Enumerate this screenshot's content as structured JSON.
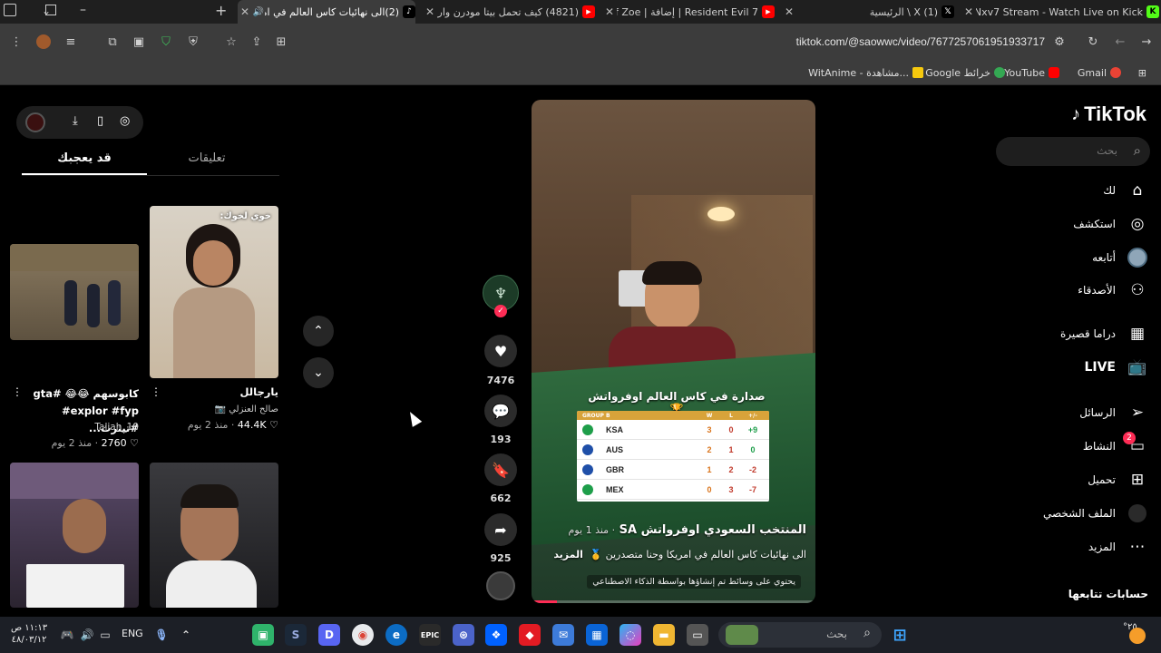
{
  "tabs": [
    {
      "title": "Nxv7 Stream - Watch Live on Kick",
      "favicon": "kick-icon",
      "color": "#53fc18"
    },
    {
      "title": "(1) X \\ الرئيسية",
      "favicon": "x-icon",
      "color": "#000000"
    },
    {
      "title": "Resident Evil 7 | إضافة | End of Zoe",
      "favicon": "youtube-icon",
      "color": "#ff0000"
    },
    {
      "title": "(4821) كيف تحمل بيتا مودرن وارفير",
      "favicon": "youtube-icon",
      "color": "#ff0000"
    },
    {
      "title": "(2)الى نهائيات كاس العالم في امريكا",
      "favicon": "tiktok-icon",
      "color": "#000000"
    }
  ],
  "address": {
    "url": "tiktok.com/@saowwc/video/7677257061951933717"
  },
  "bookmarks": [
    {
      "label": "Gmail",
      "icon": "gmail-icon",
      "color": "#ea4335"
    },
    {
      "label": "YouTube",
      "icon": "youtube-icon",
      "color": "#ff0000"
    },
    {
      "label": "Google خرائط",
      "icon": "maps-icon",
      "color": "#34a853"
    },
    {
      "label": "WitAnime - مشاهدة...",
      "icon": "witanime-icon",
      "color": "#f6c90e"
    }
  ],
  "sidebar": {
    "brand": "TikTok",
    "search_placeholder": "بحث",
    "items": [
      {
        "label": "لك",
        "icon": "home-icon"
      },
      {
        "label": "استكشف",
        "icon": "compass-icon"
      },
      {
        "label": "أتابعه",
        "icon": "following-avatar-icon"
      },
      {
        "label": "الأصدقاء",
        "icon": "friends-icon"
      },
      {
        "label": "دراما قصيرة",
        "icon": "film-icon"
      },
      {
        "label": "LIVE",
        "icon": "live-tv-icon"
      },
      {
        "label": "الرسائل",
        "icon": "send-icon"
      },
      {
        "label": "النشاط",
        "icon": "inbox-icon",
        "badge": "2"
      },
      {
        "label": "تحميل",
        "icon": "upload-icon"
      },
      {
        "label": "الملف الشخصي",
        "icon": "profile-avatar-icon"
      },
      {
        "label": "المزيد",
        "icon": "more-dots-icon"
      }
    ],
    "following_header": "حسابات تتابعها"
  },
  "video": {
    "author": "المنتخب السعودي اوفرواتش SA",
    "time": "منذ 1 يوم",
    "caption": "الى نهائيات كاس العالم في امريكا وحنا متصدرين",
    "more": "المزيد",
    "ai_notice": "يحتوي على وسائط تم إنشاؤها بواسطة الذكاء الاصطناعي",
    "overlay_title": "صدارة في كاس العالم اوفرواتش",
    "table": {
      "header": [
        "GROUP B",
        "W",
        "L",
        "+/-"
      ],
      "rows": [
        {
          "team": "KSA",
          "w": "3",
          "l": "0",
          "diff": "+9",
          "color": "#1e9e4a"
        },
        {
          "team": "AUS",
          "w": "2",
          "l": "1",
          "diff": "0",
          "color": "#1f4fa8"
        },
        {
          "team": "GBR",
          "w": "1",
          "l": "2",
          "diff": "-2",
          "color": "#1f4fa8"
        },
        {
          "team": "MEX",
          "w": "0",
          "l": "3",
          "diff": "-7",
          "color": "#1e9e4a"
        }
      ]
    }
  },
  "actions": {
    "likes": "7476",
    "comments": "193",
    "saves": "662",
    "shares": "925"
  },
  "left_panel": {
    "tabs": {
      "comments": "تعليقات",
      "you_may_like": "قد يعجبك"
    },
    "cards": [
      {
        "title": "يارجالل",
        "author": "صالح العنزلي 📷",
        "views": "44.4K",
        "time": "منذ 2 يوم",
        "overlay": "خوي لخوك:"
      },
      {
        "title": "كابوسهم 😂😂 #gta #explor #fyp #تبثرث...",
        "author": "Taliah_10",
        "views": "2760",
        "time": "منذ 2 يوم"
      }
    ]
  },
  "taskbar": {
    "search_placeholder": "بحث",
    "lang": "ENG",
    "time": "١١:١٣ ص",
    "date": "٤٨/٠٣/١٢"
  }
}
